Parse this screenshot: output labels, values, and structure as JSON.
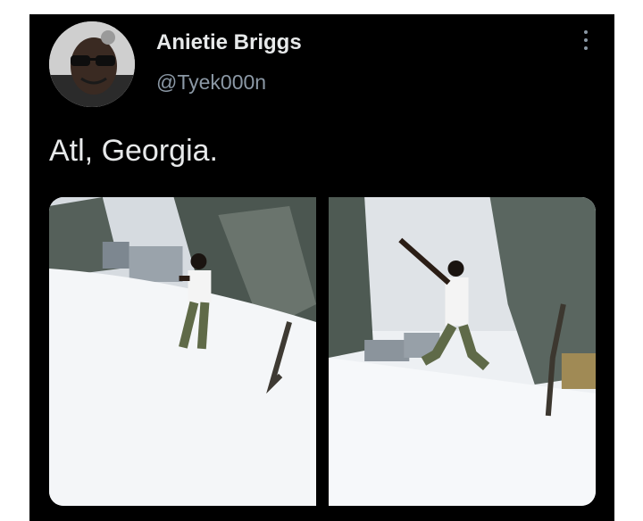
{
  "tweet": {
    "display_name": "Anietie Briggs",
    "handle": "@Tyek000n",
    "text": "Atl, Georgia.",
    "avatar_icon": "user-avatar-photo",
    "menu_icon": "more-vertical-icon",
    "media": [
      {
        "alt": "person standing in snow"
      },
      {
        "alt": "person jumping in snow"
      }
    ]
  },
  "colors": {
    "background": "#000000",
    "text_primary": "#e7e9ea",
    "text_secondary": "#8b98a5"
  }
}
